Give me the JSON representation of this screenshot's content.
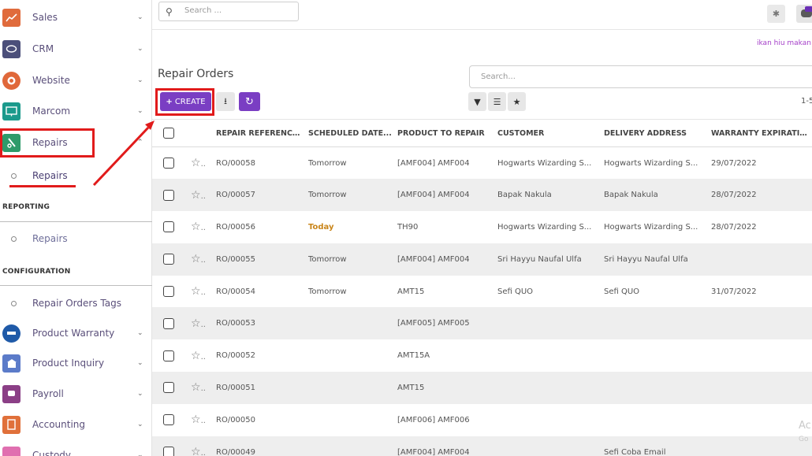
{
  "sidebar": {
    "apps": [
      {
        "label": "Sales",
        "icon": "sales-chart-icon",
        "color": "#e06b3c"
      },
      {
        "label": "CRM",
        "icon": "crm-handshake-icon",
        "color": "#4b4f7a"
      },
      {
        "label": "Website",
        "icon": "website-globe-icon",
        "color": "#e0683a"
      },
      {
        "label": "Marcom",
        "icon": "marcom-screen-icon",
        "color": "#1b9a8c"
      },
      {
        "label": "Repairs",
        "icon": "repairs-tools-icon",
        "color": "#2e9b6a"
      }
    ],
    "repairs_sub": "Repairs",
    "reporting_title": "REPORTING",
    "reporting_item": "Repairs",
    "configuration_title": "CONFIGURATION",
    "configuration_item": "Repair Orders Tags",
    "more_apps": [
      {
        "label": "Product Warranty",
        "icon": "warranty-badge-icon",
        "color": "#1f5aa8"
      },
      {
        "label": "Product Inquiry",
        "icon": "inquiry-box-icon",
        "color": "#5b7bc9"
      },
      {
        "label": "Payroll",
        "icon": "payroll-chat-icon",
        "color": "#8b3f86"
      },
      {
        "label": "Accounting",
        "icon": "accounting-doc-icon",
        "color": "#e0703a"
      },
      {
        "label": "Custody",
        "icon": "custody-icon",
        "color": "#e06fb0"
      }
    ]
  },
  "topbar": {
    "search_placeholder": "Search ...",
    "company": "ikan hiu makan t"
  },
  "control": {
    "title": "Repair Orders",
    "search_placeholder": "Search...",
    "create_label": "CREATE",
    "pager": "1-5"
  },
  "table": {
    "columns": [
      "REPAIR REFERENCE...",
      "SCHEDULED DATE...",
      "PRODUCT TO REPAIR",
      "CUSTOMER",
      "DELIVERY ADDRESS",
      "WARRANTY EXPIRATIO..."
    ],
    "rows": [
      {
        "ref": "RO/00058",
        "date": "Tomorrow",
        "product": "[AMF004] AMF004",
        "customer": "Hogwarts Wizarding S...",
        "address": "Hogwarts Wizarding S...",
        "warranty": "29/07/2022"
      },
      {
        "ref": "RO/00057",
        "date": "Tomorrow",
        "product": "[AMF004] AMF004",
        "customer": "Bapak Nakula",
        "address": "Bapak Nakula",
        "warranty": "28/07/2022"
      },
      {
        "ref": "RO/00056",
        "date": "Today",
        "product": "TH90",
        "customer": "Hogwarts Wizarding S...",
        "address": "Hogwarts Wizarding S...",
        "warranty": "28/07/2022"
      },
      {
        "ref": "RO/00055",
        "date": "Tomorrow",
        "product": "[AMF004] AMF004",
        "customer": "Sri Hayyu Naufal Ulfa",
        "address": "Sri Hayyu Naufal Ulfa",
        "warranty": ""
      },
      {
        "ref": "RO/00054",
        "date": "Tomorrow",
        "product": "AMT15",
        "customer": "Sefi QUO",
        "address": "Sefi QUO",
        "warranty": "31/07/2022"
      },
      {
        "ref": "RO/00053",
        "date": "",
        "product": "[AMF005] AMF005",
        "customer": "",
        "address": "",
        "warranty": ""
      },
      {
        "ref": "RO/00052",
        "date": "",
        "product": "AMT15A",
        "customer": "",
        "address": "",
        "warranty": ""
      },
      {
        "ref": "RO/00051",
        "date": "",
        "product": "AMT15",
        "customer": "",
        "address": "",
        "warranty": ""
      },
      {
        "ref": "RO/00050",
        "date": "",
        "product": "[AMF006] AMF006",
        "customer": "",
        "address": "",
        "warranty": ""
      },
      {
        "ref": "RO/00049",
        "date": "",
        "product": "[AMF004] AMF004",
        "customer": "",
        "address": "Sefi Coba Email",
        "warranty": ""
      }
    ]
  },
  "watermark": {
    "line1": "Ac",
    "line2": "Go"
  },
  "colors": {
    "accent": "#7a3ec3",
    "annotation": "#e11b1b",
    "today": "#c9851a"
  }
}
